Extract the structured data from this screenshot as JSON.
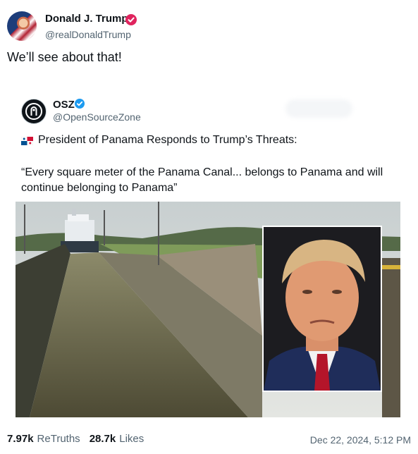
{
  "author": {
    "name": "Donald J. Trump",
    "handle": "@realDonaldTrump",
    "verified_color": "#e0245e"
  },
  "post": {
    "text": "We’ll see about that!"
  },
  "quoted": {
    "name": "OSZ",
    "handle": "@OpenSourceZone",
    "verified_color": "#1d9bf0",
    "headline": "President of Panama Responds to Trump’s Threats:",
    "quote": "“Every square meter of the Panama Canal... belongs to Panama and will continue belonging to Panama”",
    "flag_icon": "panama-flag-icon"
  },
  "stats": {
    "retruths_count": "7.97k",
    "retruths_label": "ReTruths",
    "likes_count": "28.7k",
    "likes_label": "Likes",
    "timestamp": "Dec 22, 2024, 5:12 PM"
  }
}
